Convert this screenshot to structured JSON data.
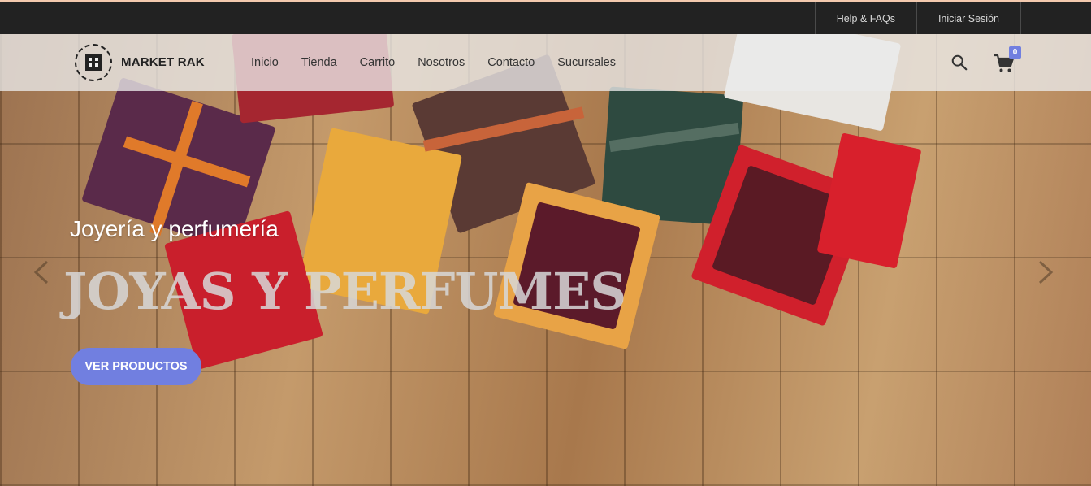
{
  "topbar": {
    "help_label": "Help & FAQs",
    "login_label": "Iniciar Sesión"
  },
  "header": {
    "brand": "MARKET RAK",
    "nav": [
      {
        "label": "Inicio"
      },
      {
        "label": "Tienda"
      },
      {
        "label": "Carrito"
      },
      {
        "label": "Nosotros"
      },
      {
        "label": "Contacto"
      },
      {
        "label": "Sucursales"
      }
    ],
    "cart_count": "0",
    "icons": [
      "search-icon",
      "cart-icon"
    ]
  },
  "hero": {
    "subtitle": "Joyería y perfumería",
    "title": "JOYAS Y PERFUMES",
    "cta_label": "VER PRODUCTOS"
  },
  "colors": {
    "accent": "#717fe0",
    "topbar": "#222222"
  }
}
